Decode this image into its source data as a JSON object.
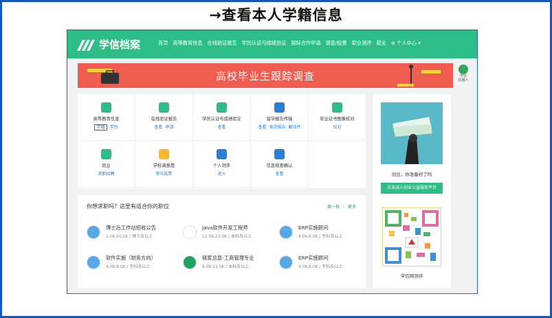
{
  "slide": {
    "title": "→查看本人学籍信息"
  },
  "site": {
    "logo_text": "学信档案",
    "nav": [
      "首页",
      "高等教育信息",
      "在线验证报告",
      "学历认证与成绩验证",
      "国际合作申请",
      "调查/投票",
      "职业测评",
      "就业",
      "⊕ 个人中心 ▾"
    ]
  },
  "banner": {
    "title": "高校毕业生跟踪调查"
  },
  "side_help": {
    "label": "学信\n机器人"
  },
  "services": [
    {
      "name": "高等教育信息",
      "links": [
        "学籍",
        "学历"
      ],
      "highlight": 0,
      "icon_color": "#2ebd86",
      "icon": "graduate-icon"
    },
    {
      "name": "在线验证报告",
      "links": [
        "查看",
        "申请"
      ],
      "highlight": -1,
      "icon_color": "#2ebd86",
      "icon": "shield-check-icon"
    },
    {
      "name": "学历认证与成绩验证",
      "links": [
        "查看"
      ],
      "highlight": -1,
      "icon_color": "#2ebd86",
      "icon": "id-card-icon"
    },
    {
      "name": "留学报告传输",
      "links": [
        "查看",
        "发送报告",
        "翻译件"
      ],
      "highlight": -1,
      "icon_color": "#2b7fd4",
      "icon": "globe-icon"
    },
    {
      "name": "毕业证书图像校对",
      "links": [
        "校对"
      ],
      "highlight": -1,
      "icon_color": "#2ebd86",
      "icon": "user-check-icon"
    },
    {
      "name": "就业",
      "links": [
        "求职招聘"
      ],
      "highlight": -1,
      "icon_color": "#2ebd86",
      "icon": "offer-icon"
    },
    {
      "name": "学校满意度",
      "links": [
        "参与投票"
      ],
      "highlight": -1,
      "icon_color": "#f5b82e",
      "icon": "smile-icon"
    },
    {
      "name": "个人测评",
      "links": [
        "进入"
      ],
      "highlight": -1,
      "icon_color": "#2b7fd4",
      "icon": "clipboard-check-icon"
    },
    {
      "name": "信息核查确认",
      "links": [
        "查看"
      ],
      "highlight": -1,
      "icon_color": "#2b7fd4",
      "icon": "user-shield-icon"
    }
  ],
  "jobs": {
    "title": "你想求职吗？这里有适合你的职位",
    "refresh": "换一批",
    "more": "更多",
    "items": [
      {
        "title": "博士后工作站招收公告",
        "sub": "1.0K-50.0K / 博士及以上",
        "icon_color": "#5aa7e6"
      },
      {
        "title": "Java软件开发工程师",
        "sub": "12.0K-23.0K / 本科及以上",
        "icon_color": "#ffffff"
      },
      {
        "title": "ERP实施顾问",
        "sub": "4.0K-8.0K / 专科及以上",
        "icon_color": "#5aa7e6"
      },
      {
        "title": "软件实施（财务方向）",
        "sub": "4.0K-8.0K / 专科及以上",
        "icon_color": "#5aa7e6"
      },
      {
        "title": "链家总部-工商管理专业",
        "sub": "6.0K-15.0K / 本科及以上",
        "icon_color": "#21a35f"
      },
      {
        "title": "ERP实施顾问",
        "sub": "4.0K-8.0K / 专科及以上",
        "icon_color": "#5aa7e6"
      }
    ]
  },
  "promo": {
    "text": "创业，你准备好了吗",
    "button": "点击进入创业公益服务平台",
    "qr_label": "学信网测评"
  }
}
